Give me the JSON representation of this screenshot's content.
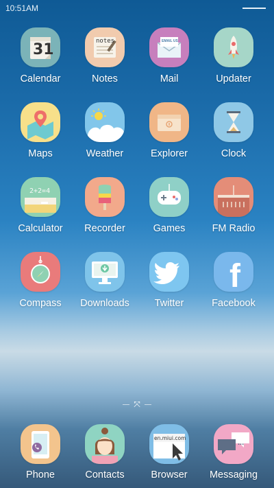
{
  "status": {
    "time": "10:51AM"
  },
  "apps": [
    {
      "label": "Calendar",
      "icon": "calendar-icon",
      "bg": "#7bb3b8",
      "date": "31"
    },
    {
      "label": "Notes",
      "icon": "notes-icon",
      "bg": "#f1cbae",
      "text": "notes"
    },
    {
      "label": "Mail",
      "icon": "mail-icon",
      "bg": "#c77fbd",
      "text": "EMAIL US"
    },
    {
      "label": "Updater",
      "icon": "rocket-icon",
      "bg": "#a6d6c8"
    },
    {
      "label": "Maps",
      "icon": "map-pin-icon",
      "bg": "#f7e08a"
    },
    {
      "label": "Weather",
      "icon": "sun-cloud-icon",
      "bg": "#82c6ea"
    },
    {
      "label": "Explorer",
      "icon": "folder-icon",
      "bg": "#f0b687"
    },
    {
      "label": "Clock",
      "icon": "hourglass-icon",
      "bg": "#8fc8e6"
    },
    {
      "label": "Calculator",
      "icon": "chalkboard-icon",
      "bg": "#8fd1b2",
      "text": "2+2=4"
    },
    {
      "label": "Recorder",
      "icon": "popsicle-icon",
      "bg": "#f2a98b"
    },
    {
      "label": "Games",
      "icon": "gamepad-icon",
      "bg": "#8fd0c7"
    },
    {
      "label": "FM Radio",
      "icon": "radio-icon",
      "bg": "#e48d78"
    },
    {
      "label": "Compass",
      "icon": "compass-icon",
      "bg": "#e97b7b"
    },
    {
      "label": "Downloads",
      "icon": "monitor-download-icon",
      "bg": "#7fc4ea"
    },
    {
      "label": "Twitter",
      "icon": "twitter-bird-icon",
      "bg": "#7ec6f0"
    },
    {
      "label": "Facebook",
      "icon": "facebook-f-icon",
      "bg": "#7ab8ec",
      "text": "f"
    }
  ],
  "dock": [
    {
      "label": "Phone",
      "icon": "phone-icon",
      "bg": "#f3c48d"
    },
    {
      "label": "Contacts",
      "icon": "contact-person-icon",
      "bg": "#8fd4c2"
    },
    {
      "label": "Browser",
      "icon": "browser-cursor-icon",
      "bg": "#7fbde6",
      "text": "en.miui.com"
    },
    {
      "label": "Messaging",
      "icon": "chat-bubbles-icon",
      "bg": "#f2a8c6",
      "text": "..."
    }
  ]
}
